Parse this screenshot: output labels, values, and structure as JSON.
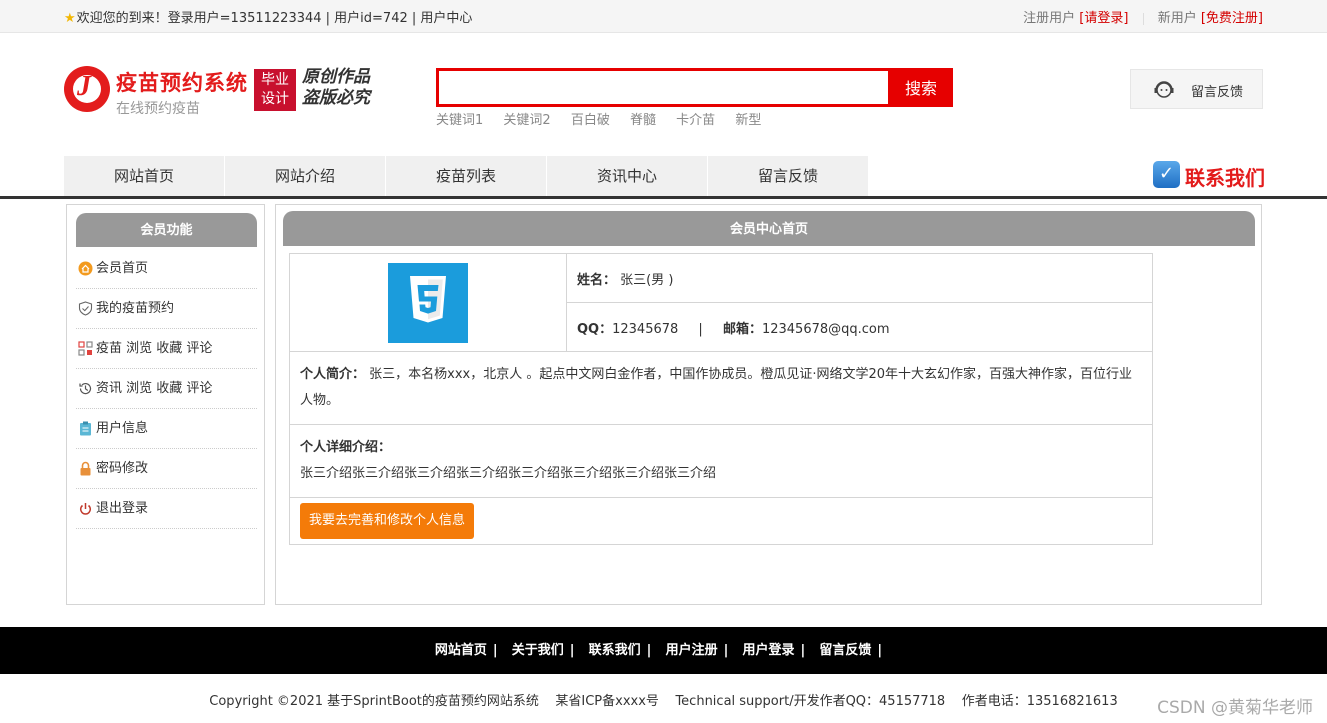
{
  "topbar": {
    "welcome": "欢迎您的到来！登录用户=13511223344 | 用户id=742 | 用户中心",
    "login_prefix": "注册用户",
    "login_link": "[请登录]",
    "register_prefix": "新用户",
    "register_link": "[免费注册]"
  },
  "logo": {
    "title": "疫苗预约系统",
    "subtitle": "在线预约疫苗",
    "badge_line1": "毕业",
    "badge_line2": "设计",
    "slogan_line1": "原创作品",
    "slogan_line2": "盗版必究"
  },
  "search": {
    "placeholder": "",
    "button": "搜索",
    "keywords": [
      "关键词1",
      "关键词2",
      "百白破",
      "脊髓",
      "卡介苗",
      "新型"
    ]
  },
  "feedback_box": {
    "label": "留言反馈"
  },
  "nav": {
    "items": [
      "网站首页",
      "网站介绍",
      "疫苗列表",
      "资讯中心",
      "留言反馈"
    ],
    "contact": "联系我们"
  },
  "sidebar": {
    "title": "会员功能",
    "items": [
      {
        "label": "会员首页",
        "icon": "home-orange-icon"
      },
      {
        "label": "我的疫苗预约",
        "icon": "shield-icon"
      },
      {
        "label": "疫苗 浏览 收藏 评论",
        "icon": "grid-icon"
      },
      {
        "label": "资讯 浏览 收藏 评论",
        "icon": "history-icon"
      },
      {
        "label": "用户信息",
        "icon": "clipboard-icon"
      },
      {
        "label": "密码修改",
        "icon": "lock-icon"
      },
      {
        "label": "退出登录",
        "icon": "power-icon"
      }
    ]
  },
  "profile": {
    "heading": "会员中心首页",
    "name_label": "姓名：",
    "name_value": "张三(男 )",
    "qq_label": "QQ：",
    "qq_value": "12345678",
    "divider": "|",
    "email_label": "邮箱：",
    "email_value": "12345678@qq.com",
    "intro_label": "个人简介：",
    "intro_value": "张三，本名杨xxx，北京人 。起点中文网白金作者，中国作协成员。橙瓜见证·网络文学20年十大玄幻作家，百强大神作家，百位行业人物。",
    "detail_label": "个人详细介绍：",
    "detail_value": "张三介绍张三介绍张三介绍张三介绍张三介绍张三介绍张三介绍张三介绍",
    "edit_button": "我要去完善和修改个人信息"
  },
  "footer": {
    "links": [
      "网站首页",
      "关于我们",
      "联系我们",
      "用户注册",
      "用户登录",
      "留言反馈"
    ],
    "copyright": "Copyright ©2021 基于SprintBoot的疫苗预约网站系统    某省ICP备xxxx号    Technical support/开发作者QQ：45157718    作者电话：13516821613"
  },
  "watermark": "CSDN @黄菊华老师",
  "colors": {
    "accent": "#e60000",
    "brand": "#e31c1c",
    "button": "#f47b09",
    "panel_head": "#999999"
  }
}
